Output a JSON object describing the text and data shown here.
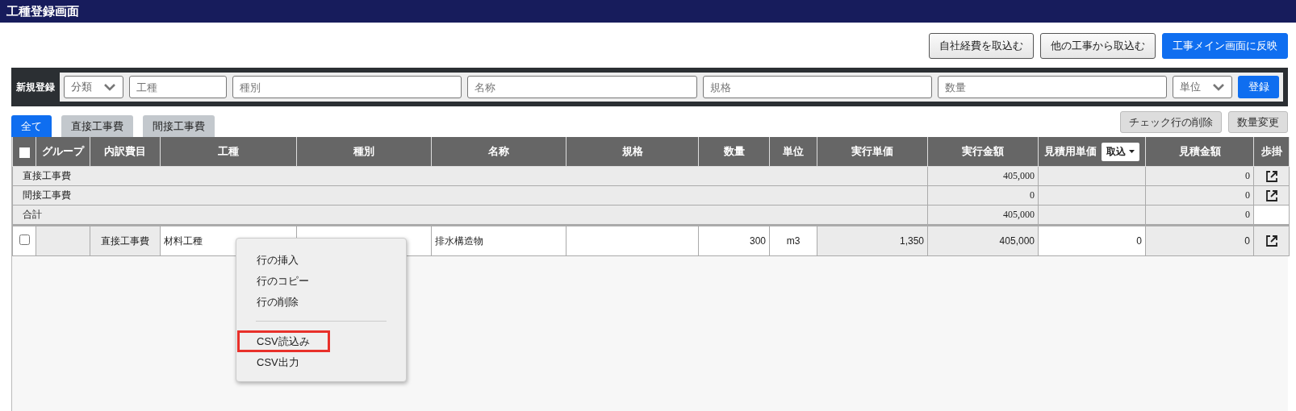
{
  "window": {
    "title": "工種登録画面"
  },
  "actions": [
    {
      "label": "自社経費を取込む",
      "primary": false
    },
    {
      "label": "他の工事から取込む",
      "primary": false
    },
    {
      "label": "工事メイン画面に反映",
      "primary": true
    }
  ],
  "entry": {
    "label": "新規登録",
    "fields": [
      {
        "kind": "select",
        "placeholder": "分類"
      },
      {
        "kind": "text",
        "placeholder": "工種"
      },
      {
        "kind": "text",
        "placeholder": "種別"
      },
      {
        "kind": "text",
        "placeholder": "名称"
      },
      {
        "kind": "text",
        "placeholder": "規格"
      },
      {
        "kind": "text",
        "placeholder": "数量"
      },
      {
        "kind": "select",
        "placeholder": "単位"
      }
    ],
    "submit": "登録"
  },
  "tabs": [
    {
      "label": "全て",
      "selected": true
    },
    {
      "label": "直接工事費",
      "selected": false
    },
    {
      "label": "間接工事費",
      "selected": false
    }
  ],
  "table_actions": [
    "チェック行の削除",
    "数量変更"
  ],
  "table": {
    "select_all_checked": false,
    "columns": [
      {
        "label": "グループ"
      },
      {
        "label": "内訳費目"
      },
      {
        "label": "工種"
      },
      {
        "label": "種別"
      },
      {
        "label": "名称"
      },
      {
        "label": "規格"
      },
      {
        "label": "数量"
      },
      {
        "label": "単位"
      },
      {
        "label": "実行単価"
      },
      {
        "label": "実行金額"
      },
      {
        "label": "見積用単価",
        "dropdown": "取込"
      },
      {
        "label": "見積金額"
      },
      {
        "label": "歩掛"
      }
    ],
    "summary_rows": [
      {
        "label": "直接工事費",
        "amount": "405,000",
        "estimate": "0",
        "link": true
      },
      {
        "label": "間接工事費",
        "amount": "0",
        "estimate": "0",
        "link": true
      },
      {
        "label": "合計",
        "amount": "405,000",
        "estimate": "0",
        "link": false
      }
    ],
    "rows": [
      {
        "checked": false,
        "item": "直接工事費",
        "work": "材料工種",
        "name": "排水構造物",
        "quantity": "300",
        "unit": "m3",
        "unit_cost": "1,350",
        "cost": "405,000",
        "estimate_price": "0",
        "estimate": "0",
        "link": true
      }
    ]
  },
  "context_menu": {
    "items": [
      {
        "kind": "item",
        "label": "行の挿入",
        "highlighted": false
      },
      {
        "kind": "item",
        "label": "行のコピー",
        "highlighted": false
      },
      {
        "kind": "item",
        "label": "行の削除",
        "highlighted": false
      },
      {
        "kind": "separator"
      },
      {
        "kind": "item",
        "label": "CSV読込み",
        "highlighted": true
      },
      {
        "kind": "item",
        "label": "CSV出力",
        "highlighted": false
      }
    ]
  }
}
